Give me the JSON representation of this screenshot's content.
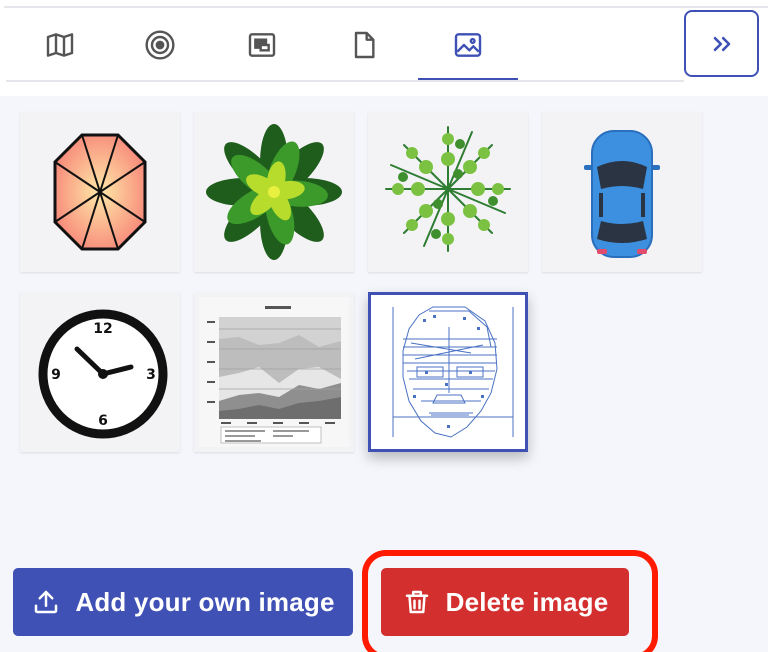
{
  "tabs": [
    {
      "icon": "map-icon",
      "active": false
    },
    {
      "icon": "target-icon",
      "active": false
    },
    {
      "icon": "picture-in-picture-icon",
      "active": false
    },
    {
      "icon": "document-icon",
      "active": false
    },
    {
      "icon": "image-icon",
      "active": true
    }
  ],
  "expand_button": {
    "icon": "chevrons-right-icon"
  },
  "gallery": {
    "items": [
      {
        "name": "octagon-umbrella",
        "selected": false
      },
      {
        "name": "green-plant",
        "selected": false
      },
      {
        "name": "fern-plant",
        "selected": false
      },
      {
        "name": "blue-car",
        "selected": false
      },
      {
        "name": "wall-clock",
        "selected": false
      },
      {
        "name": "area-chart",
        "selected": false
      },
      {
        "name": "face-wireframe",
        "selected": true
      }
    ],
    "clock_labels": {
      "twelve": "12",
      "three": "3",
      "six": "6",
      "nine": "9"
    }
  },
  "buttons": {
    "add_label": "Add your own image",
    "delete_label": "Delete image"
  },
  "colors": {
    "primary": "#3f51b5",
    "danger": "#d32f2f",
    "highlight": "#ff1a00"
  }
}
